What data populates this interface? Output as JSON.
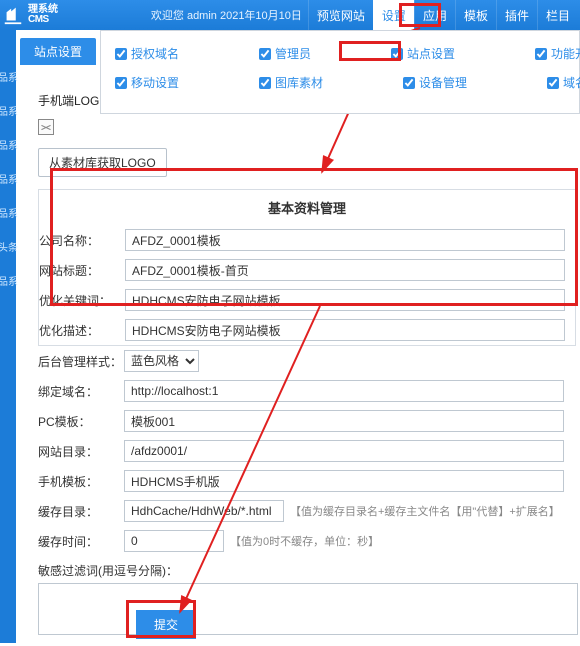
{
  "header": {
    "brand_top": "理系统",
    "brand_bottom": "CMS",
    "welcome": "欢迎您 admin  2021年10月10日",
    "nav": [
      "预览网站",
      "设置",
      "应用",
      "模板",
      "插件",
      "栏目"
    ],
    "active_index": 1
  },
  "subtab": "站点设置",
  "submenu": {
    "row1": [
      "授权域名",
      "管理员",
      "站点设置",
      "功能开关"
    ],
    "row2": [
      "移动设置",
      "图库素材",
      "设备管理",
      "域名设置"
    ]
  },
  "logo_section": {
    "label": "手机端LOGO图",
    "get_from_lib": "从素材库获取LOGO"
  },
  "card_title": "基本资料管理",
  "fields": {
    "company_label": "公司名称：",
    "company_value": "AFDZ_0001模板",
    "site_title_label": "网站标题：",
    "site_title_value": "AFDZ_0001模板-首页",
    "keywords_label": "优化关键词：",
    "keywords_value": "HDHCMS安防电子网站模板",
    "description_label": "优化描述：",
    "description_value": "HDHCMS安防电子网站模板",
    "admin_style_label": "后台管理样式：",
    "admin_style_value": "蓝色风格",
    "bind_domain_label": "绑定域名：",
    "bind_domain_value": "http://localhost:1",
    "pc_tpl_label": "PC模板：",
    "pc_tpl_value": "模板001",
    "site_dir_label": "网站目录：",
    "site_dir_value": "/afdz0001/",
    "mobile_tpl_label": "手机模板：",
    "mobile_tpl_value": "HDHCMS手机版",
    "cache_dir_label": "缓存目录：",
    "cache_dir_value": "HdhCache/HdhWeb/*.html",
    "cache_dir_hint": "【值为缓存目录名+缓存主文件名【用\"代替】+扩展名】",
    "cache_time_label": "缓存时间：",
    "cache_time_value": "0",
    "cache_time_hint": "【值为0时不缓存，单位：秒】",
    "filter_label": "敏感过滤词(用逗号分隔)：",
    "filter_value": ""
  },
  "submit_label": "提交",
  "left_crop": [
    "品系",
    "品系",
    "品系",
    "品系",
    "品系",
    "头条",
    "品系"
  ]
}
